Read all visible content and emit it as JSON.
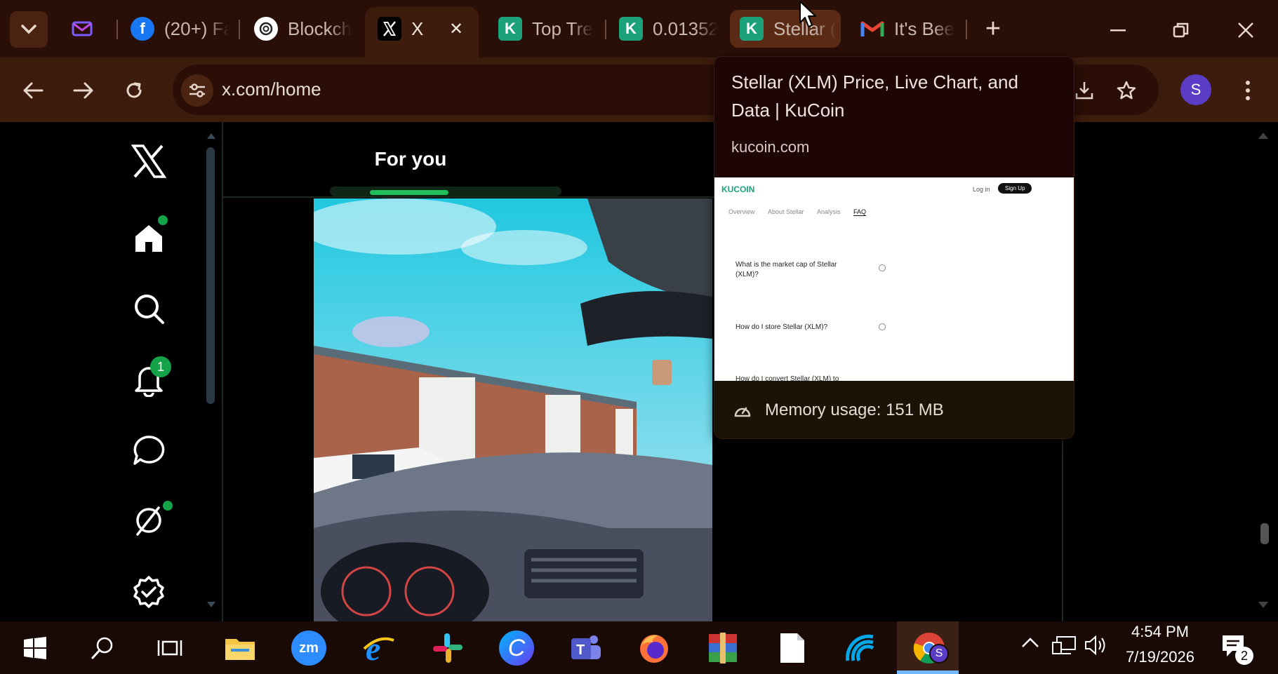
{
  "browser": {
    "tabs": [
      {
        "title": "",
        "icon": "mail-icon"
      },
      {
        "title": "(20+) Fa",
        "icon": "facebook-icon"
      },
      {
        "title": "Blockch",
        "icon": "openai-icon"
      },
      {
        "title": "X",
        "icon": "x-logo-icon",
        "active": true
      },
      {
        "title": "Top Tre",
        "icon": "kucoin-icon"
      },
      {
        "title": "0.01352",
        "icon": "kucoin-icon"
      },
      {
        "title": "Stellar (",
        "icon": "kucoin-icon"
      },
      {
        "title": "It's Bee",
        "icon": "gmail-icon"
      }
    ],
    "url": "x.com/home",
    "profile_initial": "S",
    "tab_close": "✕",
    "new_tab": "+"
  },
  "x": {
    "tab_for_you": "For you",
    "notifications_badge": "1"
  },
  "hover_card": {
    "title": "Stellar (XLM) Price, Live Chart, and Data | KuCoin",
    "domain": "kucoin.com",
    "memory": "Memory usage: 151 MB",
    "preview": {
      "brand": "KUCOIN",
      "login": "Log in",
      "signup": "Sign Up",
      "nav": [
        "Overview",
        "About Stellar",
        "Analysis",
        "FAQ"
      ],
      "faq": [
        "What is the market cap of Stellar (XLM)?",
        "How do I store Stellar (XLM)?",
        "How do I convert Stellar (XLM) to"
      ]
    }
  },
  "taskbar": {
    "time": "4:54 PM",
    "date": "7/19/2026",
    "notif_count": "2",
    "chrome_badge": "S"
  },
  "colors": {
    "accent": "#1d9bf0",
    "green": "#15a34a",
    "tabbar": "#2a0f08",
    "toolbar": "#3d1c0d"
  }
}
